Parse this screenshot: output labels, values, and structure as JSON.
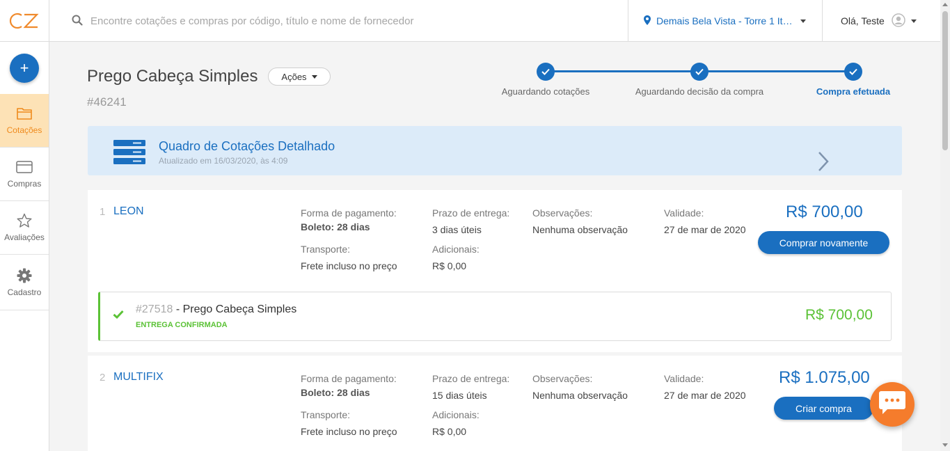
{
  "app": {
    "logo_text": "CZ"
  },
  "search": {
    "placeholder": "Encontre cotações e compras por código, título e nome de fornecedor"
  },
  "location": {
    "label": "Demais Bela Vista - Torre 1 Itaim"
  },
  "user": {
    "greeting": "Olá, Teste"
  },
  "sidebar": {
    "new_button": "+",
    "items": [
      {
        "label": "Cotações",
        "icon": "folder-icon",
        "active": true
      },
      {
        "label": "Compras",
        "icon": "card-icon",
        "active": false
      },
      {
        "label": "Avaliações",
        "icon": "star-icon",
        "active": false
      },
      {
        "label": "Cadastro",
        "icon": "gear-icon",
        "active": false
      }
    ]
  },
  "quote": {
    "title": "Prego Cabeça Simples",
    "actions_label": "Ações",
    "code": "#46241"
  },
  "steps": [
    {
      "label": "Aguardando cotações",
      "done": true
    },
    {
      "label": "Aguardando decisão da compra",
      "done": true
    },
    {
      "label": "Compra efetuada",
      "done": true,
      "current": true
    }
  ],
  "banner": {
    "title": "Quadro de Cotações Detalhado",
    "subtitle": "Atualizado em 16/03/2020, às 4:09"
  },
  "offers": [
    {
      "index": "1",
      "supplier": "LEON",
      "payment_label": "Forma de pagamento:",
      "payment_value": "Boleto: 28 dias",
      "delivery_label": "Prazo de entrega:",
      "delivery_value": "3 dias úteis",
      "notes_label": "Observações:",
      "notes_value": "Nenhuma observação",
      "validity_label": "Validade:",
      "validity_value": "27 de mar de 2020",
      "transport_label": "Transporte:",
      "transport_value": "Frete incluso no preço",
      "extras_label": "Adicionais:",
      "extras_value": "R$ 0,00",
      "price": "R$ 700,00",
      "action_label": "Comprar novamente",
      "item": {
        "code": "#27518",
        "separator": " - ",
        "name": "Prego Cabeça Simples",
        "status": "ENTREGA CONFIRMADA",
        "price": "R$ 700,00"
      }
    },
    {
      "index": "2",
      "supplier": "MULTIFIX",
      "payment_label": "Forma de pagamento:",
      "payment_value": "Boleto: 28 dias",
      "delivery_label": "Prazo de entrega:",
      "delivery_value": "15 dias úteis",
      "notes_label": "Observações:",
      "notes_value": "Nenhuma observação",
      "validity_label": "Validade:",
      "validity_value": "27 de mar de 2020",
      "transport_label": "Transporte:",
      "transport_value": "Frete incluso no preço",
      "extras_label": "Adicionais:",
      "extras_value": "R$ 0,00",
      "price": "R$ 1.075,00",
      "action_label": "Criar compra"
    }
  ],
  "colors": {
    "primary": "#1a6fc0",
    "accent_orange": "#ef8a1c",
    "success": "#5bc236",
    "banner_bg": "#dcebf9",
    "chat": "#f57c2c"
  }
}
